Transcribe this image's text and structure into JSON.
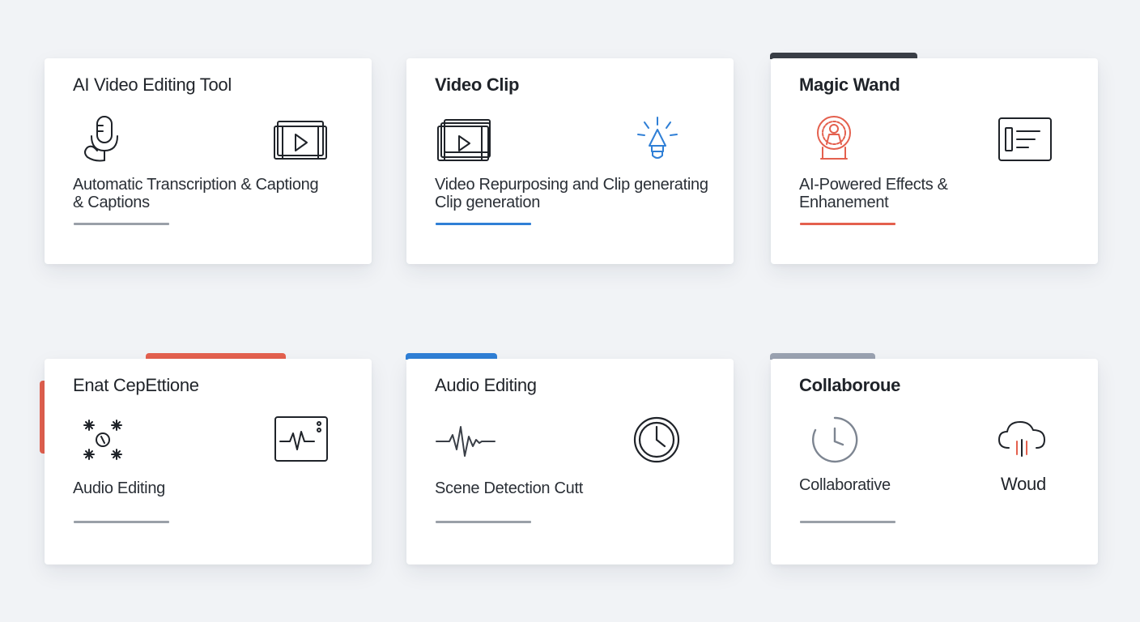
{
  "colors": {
    "background": "#f1f3f6",
    "gray": "#9aa0a8",
    "blue": "#2f7fd6",
    "red": "#e4604e",
    "dark": "#3a3f47",
    "tab_gray": "#9aa2b1"
  },
  "cards": [
    {
      "title": "AI Video Editing Tool",
      "icons": [
        "microphone-icon",
        "video-play-icon"
      ],
      "description": [
        "Automatic Transcription & Captiong",
        "& Captions"
      ],
      "underline_color": "#9aa0a8"
    },
    {
      "title": "Video Clip",
      "icons": [
        "clip-stack-icon",
        "lightbulb-icon"
      ],
      "description": [
        "Video Repurposing and Clip generating",
        "Clip generation"
      ],
      "underline_color": "#2f7fd6"
    },
    {
      "title": "Magic Wand",
      "icons": [
        "magic-badge-icon",
        "text-panel-icon"
      ],
      "description": [
        "AI-Powered Effects &",
        "Enhanement"
      ],
      "underline_color": "#e4604e"
    },
    {
      "title": "Enat CepEttione",
      "icons": [
        "sparkle-nodes-icon",
        "waveform-monitor-icon"
      ],
      "description": [
        "Audio Editing"
      ],
      "underline_color": "#9aa0a8"
    },
    {
      "title": "Audio Editing",
      "icons": [
        "audio-waveform-icon",
        "clock-icon"
      ],
      "description": [
        "Scene Detection Cutt"
      ],
      "underline_color": "#9aa0a8"
    },
    {
      "title": "Collaboroue",
      "icons": [
        "history-clock-icon",
        "cloud-icon"
      ],
      "description": [
        "Collaborative"
      ],
      "side_label": "Woud",
      "underline_color": "#9aa0a8"
    }
  ]
}
